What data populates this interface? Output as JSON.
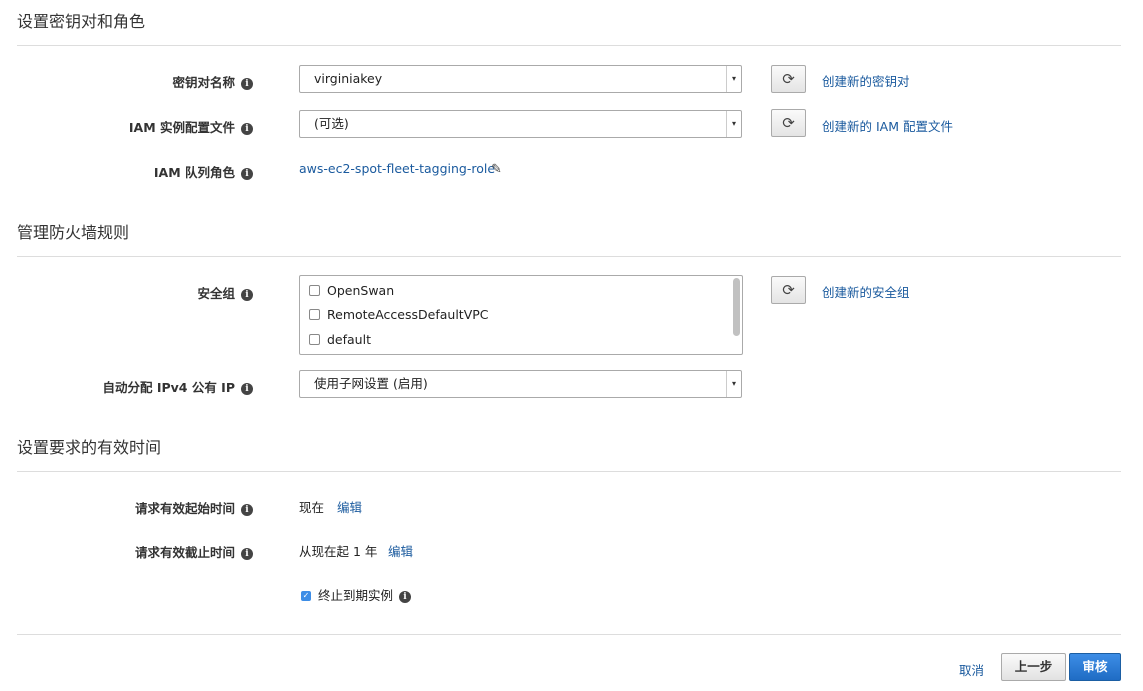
{
  "section1": {
    "title": "设置密钥对和角色",
    "keypair": {
      "label": "密钥对名称",
      "value": "virginiakey",
      "create_link": "创建新的密钥对"
    },
    "iam_profile": {
      "label": "IAM 实例配置文件",
      "value": "(可选)",
      "create_link": "创建新的 IAM 配置文件"
    },
    "fleet_role": {
      "label": "IAM 队列角色",
      "value": "aws-ec2-spot-fleet-tagging-role"
    }
  },
  "section2": {
    "title": "管理防火墙规则",
    "security_group": {
      "label": "安全组",
      "items": [
        {
          "name": "OpenSwan",
          "checked": false
        },
        {
          "name": "RemoteAccessDefaultVPC",
          "checked": false
        },
        {
          "name": "default",
          "checked": false
        }
      ],
      "create_link": "创建新的安全组"
    },
    "public_ip": {
      "label": "自动分配 IPv4 公有 IP",
      "value": "使用子网设置 (启用)"
    }
  },
  "section3": {
    "title": "设置要求的有效时间",
    "valid_from": {
      "label": "请求有效起始时间",
      "value": "现在",
      "edit_link": "编辑"
    },
    "valid_until": {
      "label": "请求有效截止时间",
      "value": "从现在起 1 年",
      "edit_link": "编辑"
    },
    "terminate": {
      "label": "终止到期实例",
      "checked": true
    }
  },
  "footer": {
    "cancel": "取消",
    "previous": "上一步",
    "review": "审核"
  },
  "colors": {
    "link": "#1a5a9e",
    "primary_button": "#2d7dd6"
  }
}
